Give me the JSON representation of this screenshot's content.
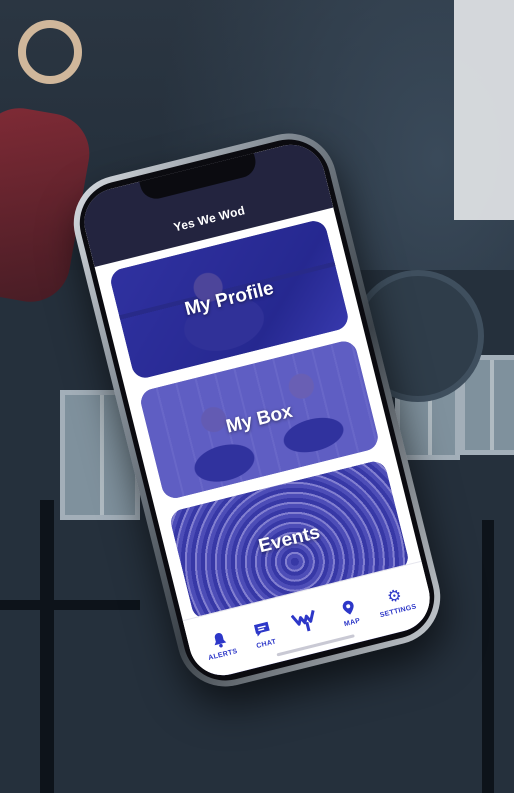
{
  "app": {
    "title": "Yes We Wod"
  },
  "cards": [
    {
      "label": "My Profile"
    },
    {
      "label": "My Box"
    },
    {
      "label": "Events"
    },
    {
      "label": ""
    }
  ],
  "tabs": [
    {
      "label": "ALERTS",
      "icon": "bell-icon"
    },
    {
      "label": "CHAT",
      "icon": "chat-icon"
    },
    {
      "label": "",
      "icon": "app-logo-icon"
    },
    {
      "label": "MAP",
      "icon": "map-pin-icon"
    },
    {
      "label": "SETTINGS",
      "icon": "gear-icon"
    }
  ],
  "colors": {
    "header": "#23243f",
    "accent": "#2d37c8",
    "card_tint": "#3434be"
  }
}
